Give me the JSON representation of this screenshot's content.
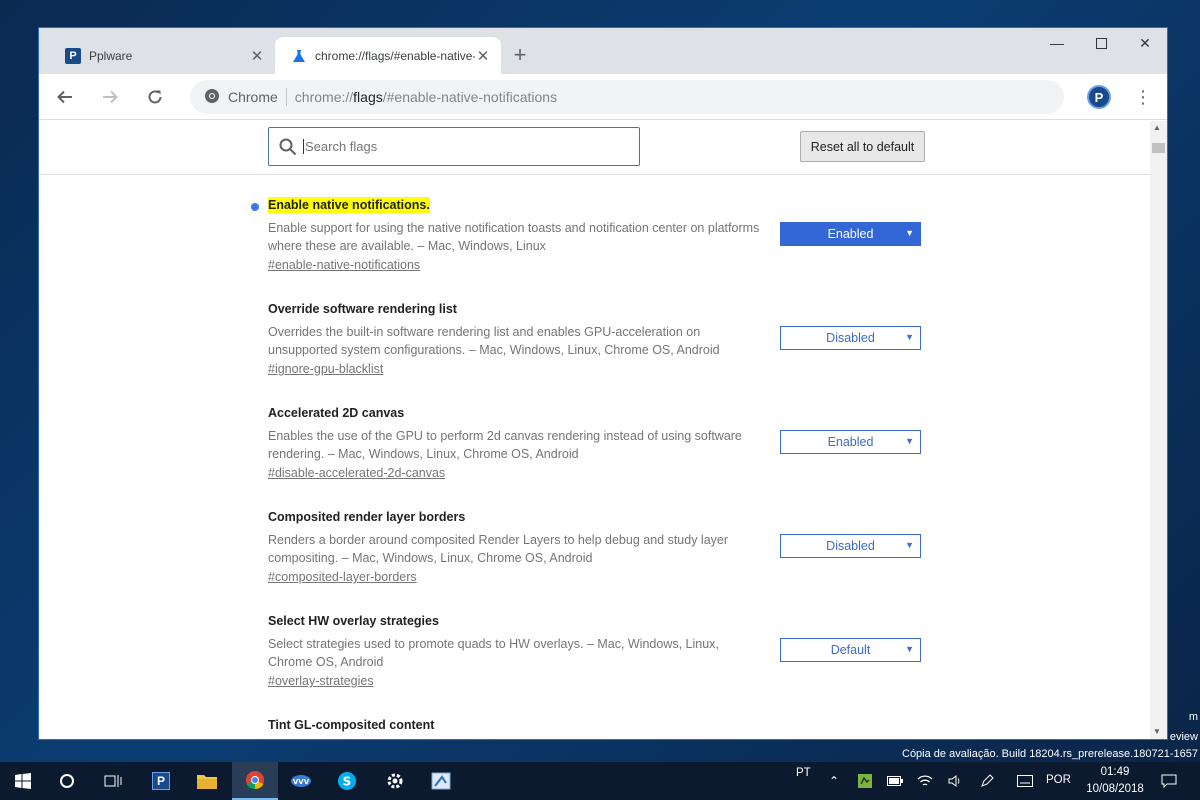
{
  "browser": {
    "tabs": [
      {
        "title": "Pplware",
        "favicon": "pplware-icon",
        "active": false
      },
      {
        "title": "chrome://flags/#enable-native-notifications",
        "favicon": "flask-icon",
        "active": true
      }
    ],
    "address": {
      "chip": "Chrome",
      "scheme": "chrome://",
      "host": "flags",
      "path": "/#enable-native-notifications"
    },
    "profile_initial": "P"
  },
  "flags_page": {
    "search_placeholder": "Search flags",
    "reset_label": "Reset all to default",
    "flags": [
      {
        "title": "Enable native notifications.",
        "description": "Enable support for using the native notification toasts and notification center on platforms where these are available. – Mac, Windows, Linux",
        "link": "#enable-native-notifications",
        "value": "Enabled",
        "highlighted": true,
        "modified": true
      },
      {
        "title": "Override software rendering list",
        "description": "Overrides the built-in software rendering list and enables GPU-acceleration on unsupported system configurations. – Mac, Windows, Linux, Chrome OS, Android",
        "link": "#ignore-gpu-blacklist",
        "value": "Disabled",
        "highlighted": false,
        "modified": false
      },
      {
        "title": "Accelerated 2D canvas",
        "description": "Enables the use of the GPU to perform 2d canvas rendering instead of using software rendering. – Mac, Windows, Linux, Chrome OS, Android",
        "link": "#disable-accelerated-2d-canvas",
        "value": "Enabled",
        "highlighted": false,
        "modified": false
      },
      {
        "title": "Composited render layer borders",
        "description": "Renders a border around composited Render Layers to help debug and study layer compositing. – Mac, Windows, Linux, Chrome OS, Android",
        "link": "#composited-layer-borders",
        "value": "Disabled",
        "highlighted": false,
        "modified": false
      },
      {
        "title": "Select HW overlay strategies",
        "description": "Select strategies used to promote quads to HW overlays. – Mac, Windows, Linux, Chrome OS, Android",
        "link": "#overlay-strategies",
        "value": "Default",
        "highlighted": false,
        "modified": false
      },
      {
        "title": "Tint GL-composited content",
        "description": "",
        "link": "",
        "value": "",
        "highlighted": false,
        "modified": false
      }
    ]
  },
  "desktop": {
    "watermark_line1": "m",
    "watermark_line2": "eview",
    "watermark_line3": "Cópia de avaliação. Build 18204.rs_prerelease.180721-1657"
  },
  "taskbar": {
    "keyboard_layout_short": "PT",
    "language": "POR",
    "time": "01:49",
    "date": "10/08/2018"
  },
  "colors": {
    "accent": "#3367d6",
    "highlight": "#ffff00",
    "modified_dot": "#3b78e7"
  }
}
